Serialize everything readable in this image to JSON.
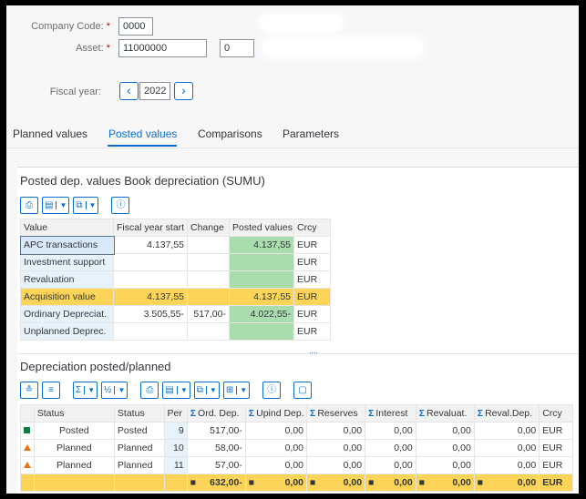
{
  "header": {
    "company_code_label": "Company Code:",
    "company_code_value": "0000",
    "asset_label": "Asset:",
    "asset_value": "11000000",
    "asset_sub_value": "0",
    "fiscal_year_label": "Fiscal year:",
    "fiscal_year_value": "2022",
    "required_mark": "*",
    "prev_icon": "chevron-left",
    "next_icon": "chevron-right"
  },
  "tabs": [
    {
      "label": "Planned values",
      "active": false
    },
    {
      "label": "Posted values",
      "active": true
    },
    {
      "label": "Comparisons",
      "active": false
    },
    {
      "label": "Parameters",
      "active": false
    }
  ],
  "posted_table": {
    "title": "Posted dep. values Book depreciation (SUMU)",
    "columns": [
      "Value",
      "Fiscal year start",
      "Change",
      "Posted values",
      "Crcy"
    ],
    "rows": [
      {
        "value": "APC transactions",
        "fy_start": "4.137,55",
        "change": "",
        "posted": "4.137,55",
        "crcy": "EUR"
      },
      {
        "value": "Investment support",
        "fy_start": "",
        "change": "",
        "posted": "",
        "crcy": "EUR"
      },
      {
        "value": "Revaluation",
        "fy_start": "",
        "change": "",
        "posted": "",
        "crcy": "EUR"
      },
      {
        "value": "Acquisition value",
        "fy_start": "4.137,55",
        "change": "",
        "posted": "4.137,55",
        "crcy": "EUR"
      },
      {
        "value": "Ordinary Depreciat.",
        "fy_start": "3.505,55-",
        "change": "517,00-",
        "posted": "4.022,55-",
        "crcy": "EUR"
      },
      {
        "value": "Unplanned Deprec.",
        "fy_start": "",
        "change": "",
        "posted": "",
        "crcy": "EUR"
      }
    ],
    "more_indicator": "...."
  },
  "depr_table": {
    "title": "Depreciation posted/planned",
    "columns": [
      "Status",
      "Status",
      "Per",
      "Ord. Dep.",
      "Upind Dep.",
      "Reserves",
      "Interest",
      "Revaluat.",
      "Reval.Dep.",
      "Crcy"
    ],
    "sum_icon": "Σ",
    "rows": [
      {
        "icon": "posted",
        "status1": "Posted",
        "status2": "Posted",
        "per": "9",
        "ord": "517,00-",
        "unpl": "0,00",
        "res": "0,00",
        "int": "0,00",
        "reval": "0,00",
        "revaldep": "0,00",
        "crcy": "EUR"
      },
      {
        "icon": "planned",
        "status1": "Planned",
        "status2": "Planned",
        "per": "10",
        "ord": "58,00-",
        "unpl": "0,00",
        "res": "0,00",
        "int": "0,00",
        "reval": "0,00",
        "revaldep": "0,00",
        "crcy": "EUR"
      },
      {
        "icon": "planned",
        "status1": "Planned",
        "status2": "Planned",
        "per": "11",
        "ord": "57,00-",
        "unpl": "0,00",
        "res": "0,00",
        "int": "0,00",
        "reval": "0,00",
        "revaldep": "0,00",
        "crcy": "EUR"
      }
    ],
    "total": {
      "bullet": "■",
      "ord": "632,00-",
      "unpl": "0,00",
      "res": "0,00",
      "int": "0,00",
      "reval": "0,00",
      "revaldep": "0,00",
      "crcy": "EUR"
    }
  },
  "colors": {
    "accent": "#0a6ed1",
    "posted_green": "#107e3e",
    "planned_orange": "#e9730c",
    "total_yellow": "#fcd558",
    "value_green": "#a9ddae"
  }
}
